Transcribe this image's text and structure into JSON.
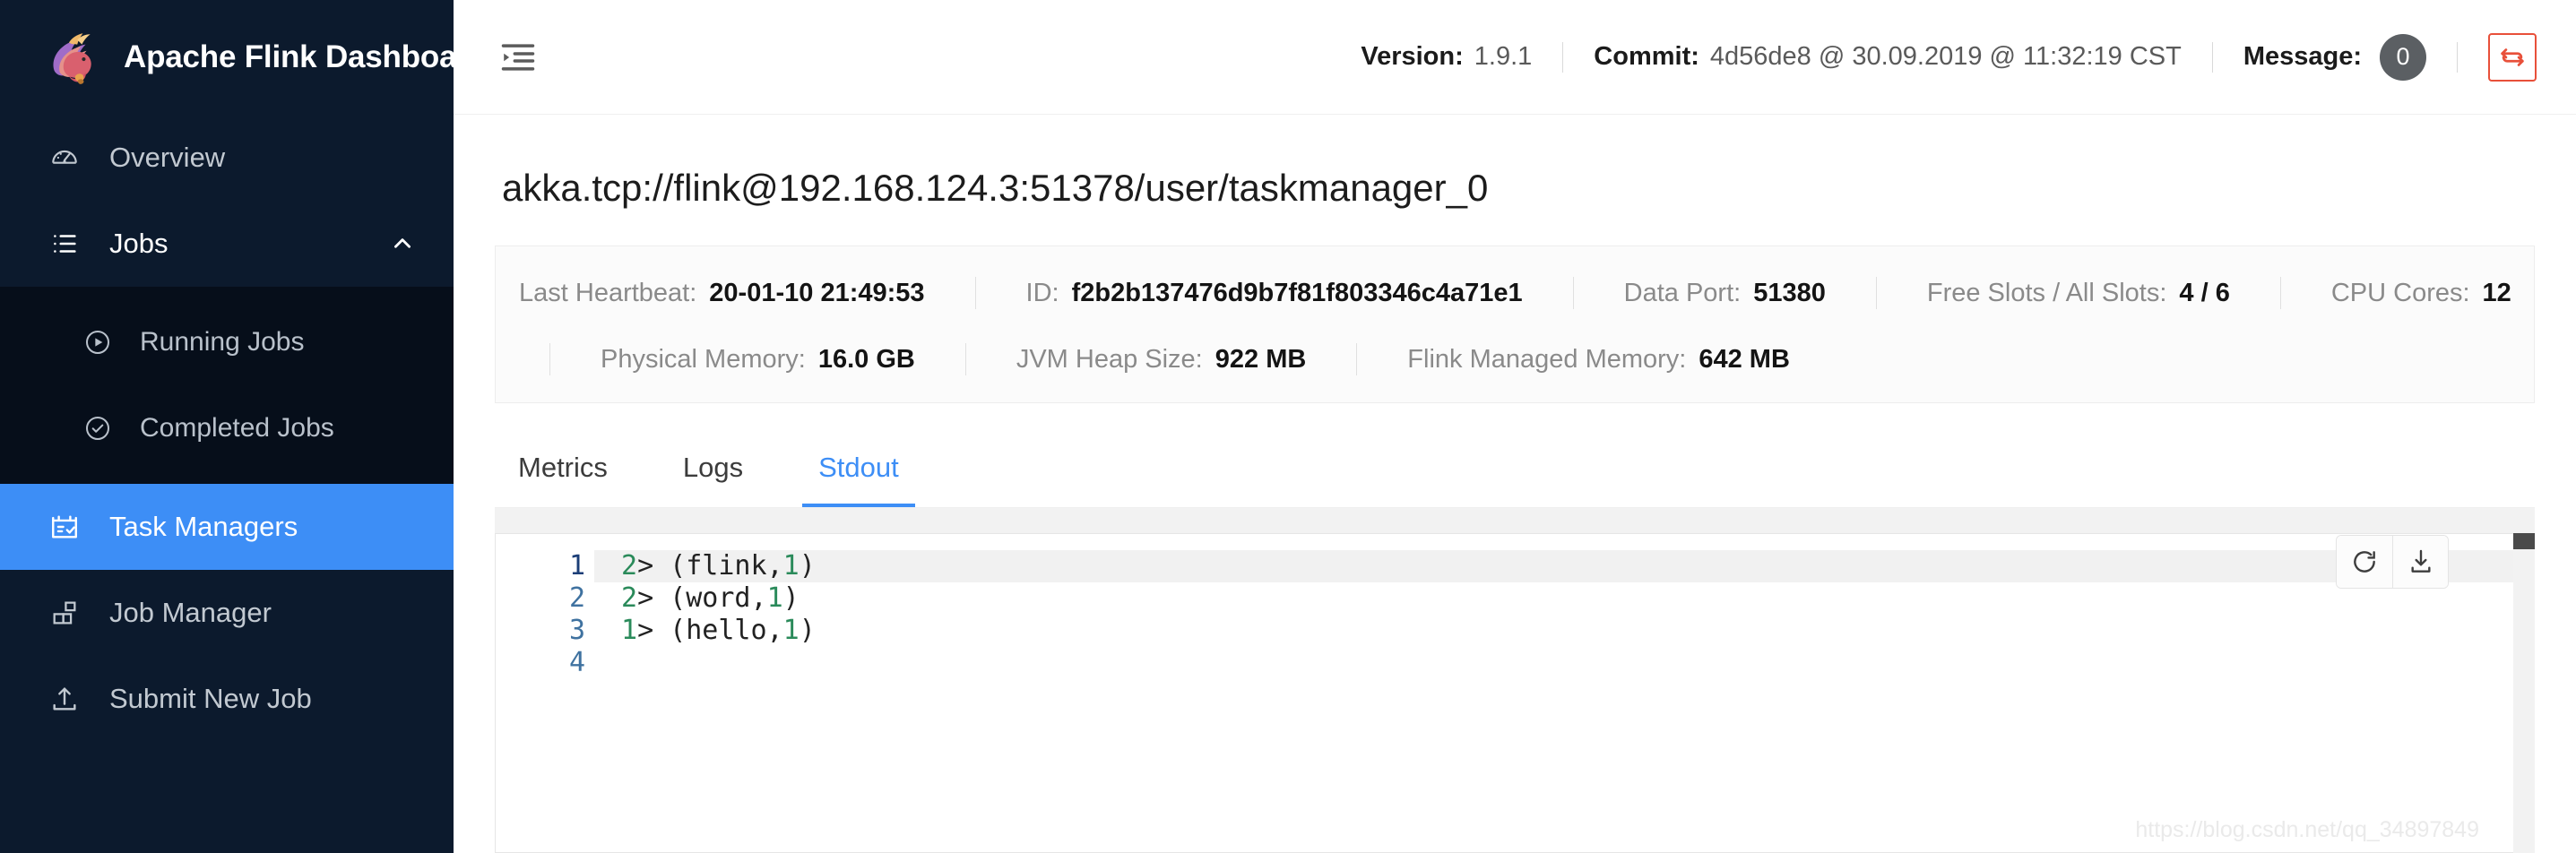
{
  "sidebar": {
    "brand": {
      "title": "Apache Flink Dashboard",
      "logo_icon": "flink-squirrel-logo"
    },
    "items": [
      {
        "label": "Overview",
        "icon": "dashboard-gauge-icon"
      },
      {
        "label": "Jobs",
        "icon": "list-icon",
        "chevron": "chevron-up-icon"
      },
      {
        "label": "Task Managers",
        "icon": "calendar-check-icon"
      },
      {
        "label": "Job Manager",
        "icon": "blocks-icon"
      },
      {
        "label": "Submit New Job",
        "icon": "upload-icon"
      }
    ],
    "submenu": [
      {
        "label": "Running Jobs",
        "icon": "play-circle-icon"
      },
      {
        "label": "Completed Jobs",
        "icon": "check-circle-icon"
      }
    ]
  },
  "topbar": {
    "fold_icon": "menu-fold-icon",
    "version_label": "Version:",
    "version_value": "1.9.1",
    "commit_label": "Commit:",
    "commit_value": "4d56de8 @ 30.09.2019 @ 11:32:19 CST",
    "message_label": "Message:",
    "message_count": "0",
    "refresh_icon": "sync-refresh-icon"
  },
  "page": {
    "title": "akka.tcp://flink@192.168.124.3:51378/user/taskmanager_0"
  },
  "info": {
    "row1": [
      {
        "key": "Last Heartbeat:",
        "value": "20-01-10 21:49:53"
      },
      {
        "key": "ID:",
        "value": "f2b2b137476d9b7f81f803346c4a71e1"
      },
      {
        "key": "Data Port:",
        "value": "51380"
      },
      {
        "key": "Free Slots / All Slots:",
        "value": "4 / 6"
      },
      {
        "key": "CPU Cores:",
        "value": "12"
      }
    ],
    "row2": [
      {
        "key": "Physical Memory:",
        "value": "16.0 GB"
      },
      {
        "key": "JVM Heap Size:",
        "value": "922 MB"
      },
      {
        "key": "Flink Managed Memory:",
        "value": "642 MB"
      }
    ]
  },
  "tabs": [
    {
      "label": "Metrics",
      "active": false
    },
    {
      "label": "Logs",
      "active": false
    },
    {
      "label": "Stdout",
      "active": true
    }
  ],
  "editor": {
    "line_numbers": [
      "1",
      "2",
      "3",
      "4"
    ],
    "lines": [
      {
        "prefix": "2",
        "rest": "> (flink,",
        "num": "1",
        "close": ")"
      },
      {
        "prefix": "2",
        "rest": "> (word,",
        "num": "1",
        "close": ")"
      },
      {
        "prefix": "1",
        "rest": "> (hello,",
        "num": "1",
        "close": ")"
      },
      {
        "prefix": "",
        "rest": "",
        "num": "",
        "close": ""
      }
    ],
    "reload_icon": "reload-icon",
    "download_icon": "download-icon",
    "watermark": "https://blog.csdn.net/qq_34897849"
  },
  "colors": {
    "sidebar_bg": "#0c1a2d",
    "submenu_bg": "#060e1a",
    "accent_blue": "#3d8ef6",
    "refresh_red": "#e8503a",
    "code_number_green": "#2a8a5a"
  }
}
